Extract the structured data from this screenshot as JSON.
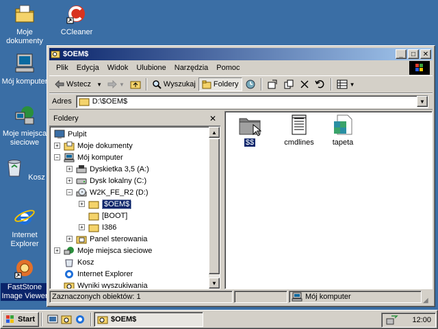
{
  "desktop": {
    "icons": [
      {
        "label": "Moje\ndokumenty",
        "icon": "my-documents-icon"
      },
      {
        "label": "CCleaner",
        "icon": "ccleaner-icon"
      },
      {
        "label": "Mój komputer",
        "icon": "my-computer-icon"
      },
      {
        "label": "Moje miejsca\nsieciowe",
        "icon": "network-places-icon"
      },
      {
        "label": "Kosz",
        "icon": "recycle-bin-icon"
      },
      {
        "label": "Internet\nExplorer",
        "icon": "internet-explorer-icon"
      },
      {
        "label": "FastStone\nImage Viewer",
        "icon": "faststone-icon"
      }
    ]
  },
  "window": {
    "title": "$OEM$",
    "buttons": {
      "minimize": "_",
      "maximize": "□",
      "close": "✕"
    }
  },
  "menu": [
    "Plik",
    "Edycja",
    "Widok",
    "Ulubione",
    "Narzędzia",
    "Pomoc"
  ],
  "toolbar": {
    "back": "Wstecz",
    "search": "Wyszukaj",
    "folders": "Foldery"
  },
  "address": {
    "label": "Adres",
    "value": "D:\\$OEM$"
  },
  "folders_pane": {
    "title": "Foldery",
    "tree": [
      {
        "label": "Pulpit",
        "expander": ""
      },
      {
        "label": "Moje dokumenty",
        "expander": "+"
      },
      {
        "label": "Mój komputer",
        "expander": "−"
      },
      {
        "label": "Dyskietka 3,5 (A:)",
        "expander": "+"
      },
      {
        "label": "Dysk lokalny (C:)",
        "expander": "+"
      },
      {
        "label": "W2K_FE_R2 (D:)",
        "expander": "−"
      },
      {
        "label": "$OEM$",
        "expander": "+"
      },
      {
        "label": "[BOOT]",
        "expander": ""
      },
      {
        "label": "I386",
        "expander": "+"
      },
      {
        "label": "Panel sterowania",
        "expander": "+"
      },
      {
        "label": "Moje miejsca sieciowe",
        "expander": "+"
      },
      {
        "label": "Kosz",
        "expander": ""
      },
      {
        "label": "Internet Explorer",
        "expander": ""
      },
      {
        "label": "Wyniki wyszukiwania",
        "expander": ""
      }
    ]
  },
  "files": [
    {
      "label": "$$",
      "icon": "folder-icon"
    },
    {
      "label": "cmdlines",
      "icon": "text-file-icon"
    },
    {
      "label": "tapeta",
      "icon": "image-file-icon"
    }
  ],
  "status": {
    "selected": "Zaznaczonych obiektów: 1",
    "location": "Mój komputer"
  },
  "taskbar": {
    "start": "Start",
    "task": "$OEM$",
    "clock": "12:00"
  },
  "colors": {
    "desktop": "#3a6ea5",
    "title_active": "#0a246a",
    "face": "#d4d0c8",
    "selection": "#0a246a"
  }
}
